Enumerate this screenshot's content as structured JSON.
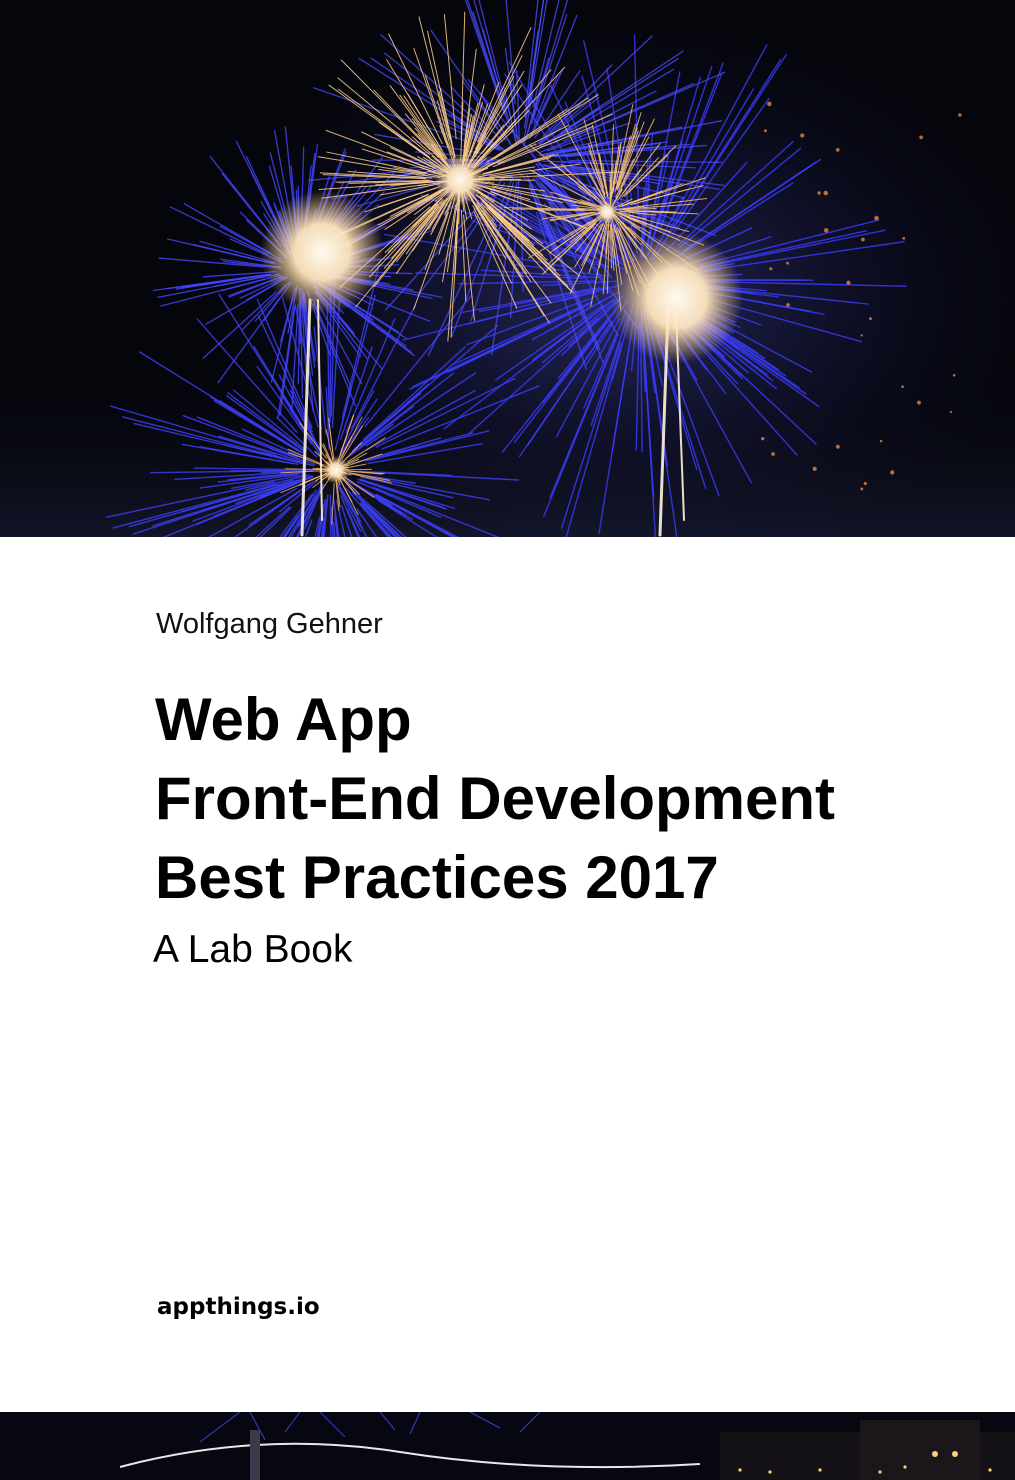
{
  "cover": {
    "author": "Wolfgang Gehner",
    "title_lines": [
      "Web App",
      "Front-End Development",
      "Best Practices 2017"
    ],
    "subtitle": "A Lab Book",
    "publisher": "appthings.io"
  },
  "colors": {
    "background": "#ffffff",
    "text": "#000000",
    "night_sky": "#05060c",
    "firework_blue": "#3a3cff",
    "firework_gold": "#ffd9a0"
  }
}
